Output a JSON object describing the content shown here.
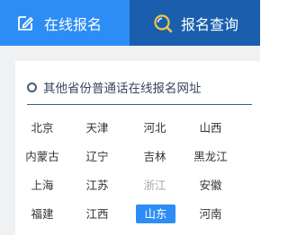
{
  "tabs": [
    {
      "label": "在线报名",
      "icon": "edit-icon"
    },
    {
      "label": "报名查询",
      "icon": "search-icon"
    }
  ],
  "colors": {
    "tab_active": "#2e8df5",
    "tab_inactive": "#1a5fae",
    "selected": "#2e8df5",
    "muted": "#a6a6a6"
  },
  "section": {
    "title": "其他省份普通话在线报名网址"
  },
  "provinces": [
    [
      "北京",
      "天津",
      "河北",
      "山西"
    ],
    [
      "内蒙古",
      "辽宁",
      "吉林",
      "黑龙江"
    ],
    [
      "上海",
      "江苏",
      "浙江",
      "安徽"
    ],
    [
      "福建",
      "江西",
      "山东",
      "河南"
    ]
  ],
  "selected_province": "山东",
  "disabled_provinces": [
    "浙江"
  ]
}
